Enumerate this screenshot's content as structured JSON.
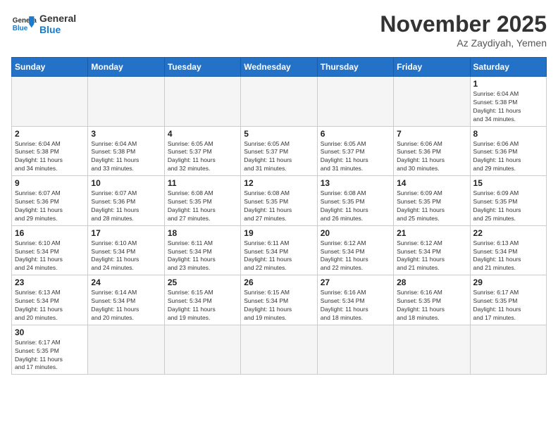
{
  "logo": {
    "text_general": "General",
    "text_blue": "Blue"
  },
  "title": "November 2025",
  "subtitle": "Az Zaydiyah, Yemen",
  "days_of_week": [
    "Sunday",
    "Monday",
    "Tuesday",
    "Wednesday",
    "Thursday",
    "Friday",
    "Saturday"
  ],
  "weeks": [
    [
      {
        "day": "",
        "info": ""
      },
      {
        "day": "",
        "info": ""
      },
      {
        "day": "",
        "info": ""
      },
      {
        "day": "",
        "info": ""
      },
      {
        "day": "",
        "info": ""
      },
      {
        "day": "",
        "info": ""
      },
      {
        "day": "1",
        "info": "Sunrise: 6:04 AM\nSunset: 5:38 PM\nDaylight: 11 hours\nand 34 minutes."
      }
    ],
    [
      {
        "day": "2",
        "info": "Sunrise: 6:04 AM\nSunset: 5:38 PM\nDaylight: 11 hours\nand 34 minutes."
      },
      {
        "day": "3",
        "info": "Sunrise: 6:04 AM\nSunset: 5:38 PM\nDaylight: 11 hours\nand 33 minutes."
      },
      {
        "day": "4",
        "info": "Sunrise: 6:05 AM\nSunset: 5:37 PM\nDaylight: 11 hours\nand 32 minutes."
      },
      {
        "day": "5",
        "info": "Sunrise: 6:05 AM\nSunset: 5:37 PM\nDaylight: 11 hours\nand 31 minutes."
      },
      {
        "day": "6",
        "info": "Sunrise: 6:05 AM\nSunset: 5:37 PM\nDaylight: 11 hours\nand 31 minutes."
      },
      {
        "day": "7",
        "info": "Sunrise: 6:06 AM\nSunset: 5:36 PM\nDaylight: 11 hours\nand 30 minutes."
      },
      {
        "day": "8",
        "info": "Sunrise: 6:06 AM\nSunset: 5:36 PM\nDaylight: 11 hours\nand 29 minutes."
      }
    ],
    [
      {
        "day": "9",
        "info": "Sunrise: 6:07 AM\nSunset: 5:36 PM\nDaylight: 11 hours\nand 29 minutes."
      },
      {
        "day": "10",
        "info": "Sunrise: 6:07 AM\nSunset: 5:36 PM\nDaylight: 11 hours\nand 28 minutes."
      },
      {
        "day": "11",
        "info": "Sunrise: 6:08 AM\nSunset: 5:35 PM\nDaylight: 11 hours\nand 27 minutes."
      },
      {
        "day": "12",
        "info": "Sunrise: 6:08 AM\nSunset: 5:35 PM\nDaylight: 11 hours\nand 27 minutes."
      },
      {
        "day": "13",
        "info": "Sunrise: 6:08 AM\nSunset: 5:35 PM\nDaylight: 11 hours\nand 26 minutes."
      },
      {
        "day": "14",
        "info": "Sunrise: 6:09 AM\nSunset: 5:35 PM\nDaylight: 11 hours\nand 25 minutes."
      },
      {
        "day": "15",
        "info": "Sunrise: 6:09 AM\nSunset: 5:35 PM\nDaylight: 11 hours\nand 25 minutes."
      }
    ],
    [
      {
        "day": "16",
        "info": "Sunrise: 6:10 AM\nSunset: 5:34 PM\nDaylight: 11 hours\nand 24 minutes."
      },
      {
        "day": "17",
        "info": "Sunrise: 6:10 AM\nSunset: 5:34 PM\nDaylight: 11 hours\nand 24 minutes."
      },
      {
        "day": "18",
        "info": "Sunrise: 6:11 AM\nSunset: 5:34 PM\nDaylight: 11 hours\nand 23 minutes."
      },
      {
        "day": "19",
        "info": "Sunrise: 6:11 AM\nSunset: 5:34 PM\nDaylight: 11 hours\nand 22 minutes."
      },
      {
        "day": "20",
        "info": "Sunrise: 6:12 AM\nSunset: 5:34 PM\nDaylight: 11 hours\nand 22 minutes."
      },
      {
        "day": "21",
        "info": "Sunrise: 6:12 AM\nSunset: 5:34 PM\nDaylight: 11 hours\nand 21 minutes."
      },
      {
        "day": "22",
        "info": "Sunrise: 6:13 AM\nSunset: 5:34 PM\nDaylight: 11 hours\nand 21 minutes."
      }
    ],
    [
      {
        "day": "23",
        "info": "Sunrise: 6:13 AM\nSunset: 5:34 PM\nDaylight: 11 hours\nand 20 minutes."
      },
      {
        "day": "24",
        "info": "Sunrise: 6:14 AM\nSunset: 5:34 PM\nDaylight: 11 hours\nand 20 minutes."
      },
      {
        "day": "25",
        "info": "Sunrise: 6:15 AM\nSunset: 5:34 PM\nDaylight: 11 hours\nand 19 minutes."
      },
      {
        "day": "26",
        "info": "Sunrise: 6:15 AM\nSunset: 5:34 PM\nDaylight: 11 hours\nand 19 minutes."
      },
      {
        "day": "27",
        "info": "Sunrise: 6:16 AM\nSunset: 5:34 PM\nDaylight: 11 hours\nand 18 minutes."
      },
      {
        "day": "28",
        "info": "Sunrise: 6:16 AM\nSunset: 5:35 PM\nDaylight: 11 hours\nand 18 minutes."
      },
      {
        "day": "29",
        "info": "Sunrise: 6:17 AM\nSunset: 5:35 PM\nDaylight: 11 hours\nand 17 minutes."
      }
    ],
    [
      {
        "day": "30",
        "info": "Sunrise: 6:17 AM\nSunset: 5:35 PM\nDaylight: 11 hours\nand 17 minutes."
      },
      {
        "day": "",
        "info": ""
      },
      {
        "day": "",
        "info": ""
      },
      {
        "day": "",
        "info": ""
      },
      {
        "day": "",
        "info": ""
      },
      {
        "day": "",
        "info": ""
      },
      {
        "day": "",
        "info": ""
      }
    ]
  ]
}
